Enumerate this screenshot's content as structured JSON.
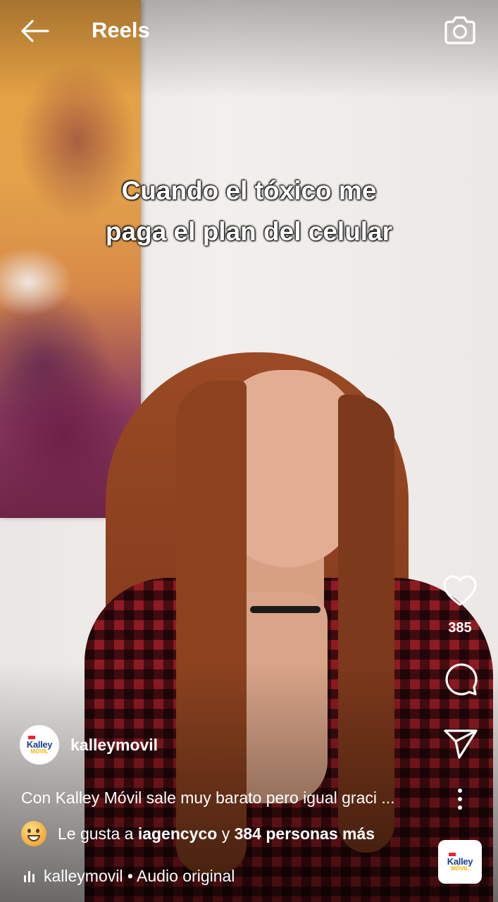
{
  "header": {
    "title": "Reels"
  },
  "video": {
    "overlay_line1": "Cuando el tóxico me",
    "overlay_line2": "paga el plan del celular"
  },
  "actions": {
    "like_count": "385"
  },
  "post": {
    "username": "kalleymovil",
    "avatar_logo": "Kalley",
    "avatar_logo_sub": "MÓVIL",
    "caption": "Con Kalley Móvil sale muy barato pero igual graci ...",
    "likes_prefix": "Le gusta a ",
    "likes_user": "iagencyco",
    "likes_middle": " y ",
    "likes_count_text": "384 personas más",
    "audio_text": "kalleymovil • Audio original"
  },
  "colors": {
    "brand_blue": "#1a3e8f",
    "brand_yellow": "#f5b400"
  },
  "icons": {
    "back": "arrow-left-icon",
    "camera": "camera-icon",
    "like": "heart-icon",
    "comment": "comment-icon",
    "share": "send-icon",
    "more": "more-vertical-icon",
    "audio": "audio-bars-icon"
  }
}
